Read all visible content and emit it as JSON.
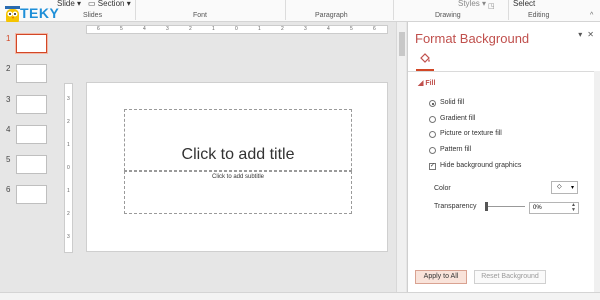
{
  "logo": {
    "brand": "TEKY",
    "tagline": "Young can do it"
  },
  "ribbon": {
    "slide_btn": "Slide",
    "section_btn": "Section",
    "styles_btn": "Styles",
    "select_btn": "Select",
    "groups": [
      "Slides",
      "Font",
      "Paragraph",
      "Drawing",
      "Editing"
    ]
  },
  "thumbnails": [
    {
      "num": "1",
      "selected": true
    },
    {
      "num": "2",
      "selected": false
    },
    {
      "num": "3",
      "selected": false
    },
    {
      "num": "4",
      "selected": false
    },
    {
      "num": "5",
      "selected": false
    },
    {
      "num": "6",
      "selected": false
    }
  ],
  "ruler": {
    "h_labels": [
      "6",
      "5",
      "4",
      "3",
      "2",
      "1",
      "0",
      "1",
      "2",
      "3",
      "4",
      "5",
      "6"
    ],
    "v_labels": [
      "3",
      "2",
      "1",
      "0",
      "1",
      "2",
      "3"
    ]
  },
  "slide": {
    "title_placeholder": "Click to add title",
    "subtitle_placeholder": "Click to add subtitle"
  },
  "pane": {
    "title": "Format Background",
    "section": "Fill",
    "options": [
      {
        "label": "Solid fill",
        "checked": true,
        "kind": "radio"
      },
      {
        "label": "Gradient fill",
        "checked": false,
        "kind": "radio"
      },
      {
        "label": "Picture or texture fill",
        "checked": false,
        "kind": "radio"
      },
      {
        "label": "Pattern fill",
        "checked": false,
        "kind": "radio"
      },
      {
        "label": "Hide background graphics",
        "checked": true,
        "kind": "checkbox"
      }
    ],
    "color_label": "Color",
    "transparency_label": "Transparency",
    "transparency_value": "0%",
    "apply_all": "Apply to All",
    "reset_background": "Reset Background"
  }
}
